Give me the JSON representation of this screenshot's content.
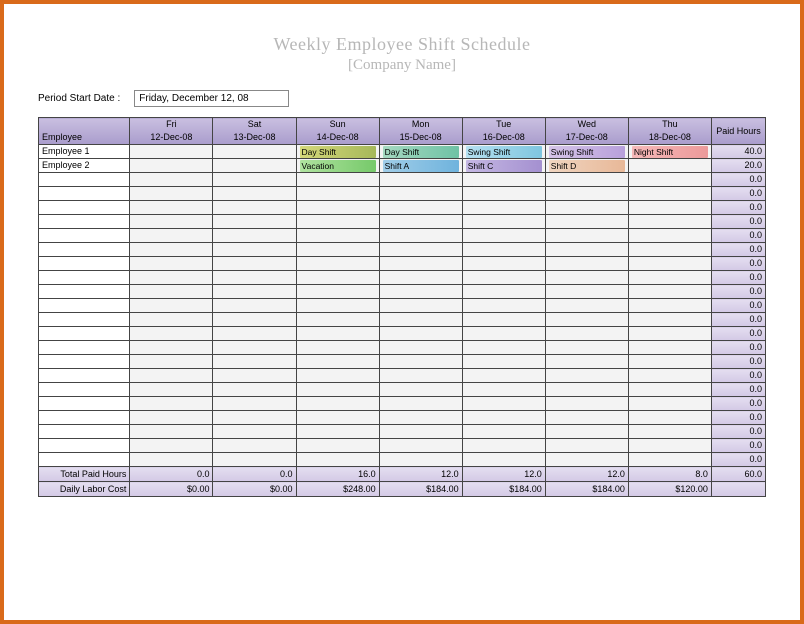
{
  "header": {
    "title": "Weekly Employee Shift Schedule",
    "subtitle": "[Company Name]"
  },
  "period": {
    "label": "Period Start Date :",
    "value": "Friday, December 12, 08"
  },
  "columns": {
    "employee": "Employee",
    "paid_hours": "Paid Hours",
    "days": [
      {
        "dow": "Fri",
        "date": "12-Dec-08"
      },
      {
        "dow": "Sat",
        "date": "13-Dec-08"
      },
      {
        "dow": "Sun",
        "date": "14-Dec-08"
      },
      {
        "dow": "Mon",
        "date": "15-Dec-08"
      },
      {
        "dow": "Tue",
        "date": "16-Dec-08"
      },
      {
        "dow": "Wed",
        "date": "17-Dec-08"
      },
      {
        "dow": "Thu",
        "date": "18-Dec-08"
      }
    ]
  },
  "rows": [
    {
      "employee": "Employee 1",
      "paid": "40.0",
      "cells": [
        null,
        null,
        {
          "label": "Day Shift",
          "cls": "s-dayshift"
        },
        {
          "label": "Day Shift",
          "cls": "s-dayshift2"
        },
        {
          "label": "Swing Shift",
          "cls": "s-swing"
        },
        {
          "label": "Swing Shift",
          "cls": "s-swing2"
        },
        {
          "label": "Night Shift",
          "cls": "s-night"
        }
      ]
    },
    {
      "employee": "Employee 2",
      "paid": "20.0",
      "cells": [
        null,
        null,
        {
          "label": "Vacation",
          "cls": "s-vacation"
        },
        {
          "label": "Shift A",
          "cls": "s-shifta"
        },
        {
          "label": "Shift C",
          "cls": "s-shiftc"
        },
        {
          "label": "Shift  D",
          "cls": "s-shiftd"
        },
        null
      ]
    }
  ],
  "empty_row_paid": "0.0",
  "totals": {
    "paid_label": "Total Paid Hours",
    "paid_values": [
      "0.0",
      "0.0",
      "16.0",
      "12.0",
      "12.0",
      "12.0",
      "8.0"
    ],
    "paid_grand": "60.0",
    "cost_label": "Daily Labor Cost",
    "cost_values": [
      "$0.00",
      "$0.00",
      "$248.00",
      "$184.00",
      "$184.00",
      "$184.00",
      "$120.00"
    ],
    "cost_grand": ""
  }
}
